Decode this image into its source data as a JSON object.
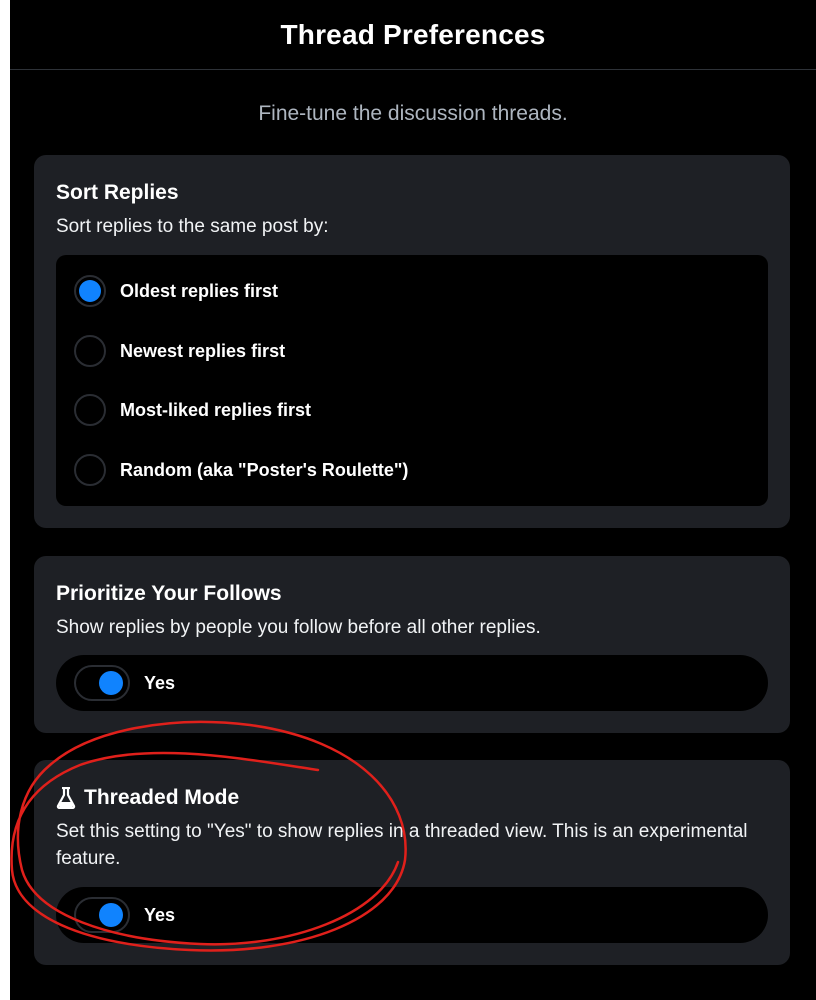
{
  "header": {
    "title": "Thread Preferences"
  },
  "subtitle": "Fine-tune the discussion threads.",
  "sort_replies": {
    "title": "Sort Replies",
    "description": "Sort replies to the same post by:",
    "options": [
      {
        "label": "Oldest replies first",
        "selected": true
      },
      {
        "label": "Newest replies first",
        "selected": false
      },
      {
        "label": "Most-liked replies first",
        "selected": false
      },
      {
        "label": "Random (aka \"Poster's Roulette\")",
        "selected": false
      }
    ]
  },
  "prioritize_follows": {
    "title": "Prioritize Your Follows",
    "description": "Show replies by people you follow before all other replies.",
    "toggle_label": "Yes",
    "enabled": true
  },
  "threaded_mode": {
    "icon": "flask-icon",
    "title": "Threaded Mode",
    "description": "Set this setting to \"Yes\" to show replies in a threaded view. This is an experimental feature.",
    "toggle_label": "Yes",
    "enabled": true
  },
  "colors": {
    "background": "#000000",
    "card": "#1e2025",
    "accent": "#1083fe",
    "annotation": "#e0201b"
  }
}
